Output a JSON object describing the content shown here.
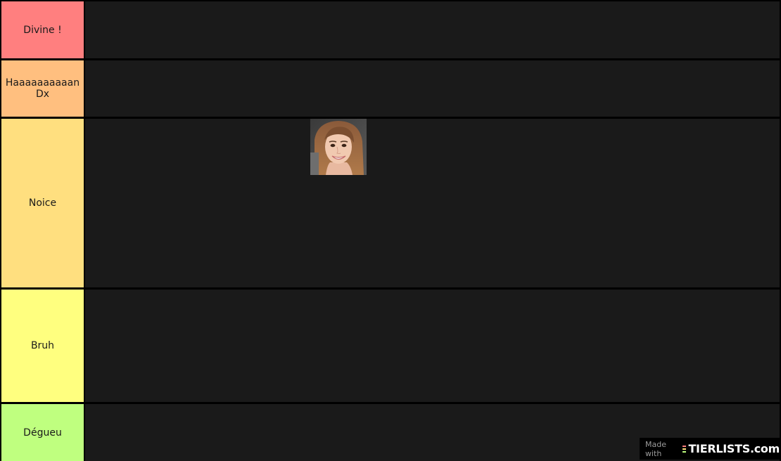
{
  "tiers": [
    {
      "label": "Divine !",
      "color": "#ff7f7f"
    },
    {
      "label": "Haaaaaaaaaan Dx",
      "color": "#ffbf7f"
    },
    {
      "label": "Noice",
      "color": "#ffdf7f"
    },
    {
      "label": "Bruh",
      "color": "#ffff7f"
    },
    {
      "label": "Dégueu",
      "color": "#bfff7f"
    }
  ],
  "items": [
    {
      "tier": "Noice",
      "icon": "portrait-photo-icon"
    }
  ],
  "watermark": {
    "made_with": "Made with",
    "brand": "TIERLISTS.com",
    "bar_colors": [
      "#ff7f7f",
      "#ffdf7f",
      "#bfff7f"
    ]
  },
  "colors": {
    "background": "#000000",
    "row_background": "#1a1a1a"
  }
}
